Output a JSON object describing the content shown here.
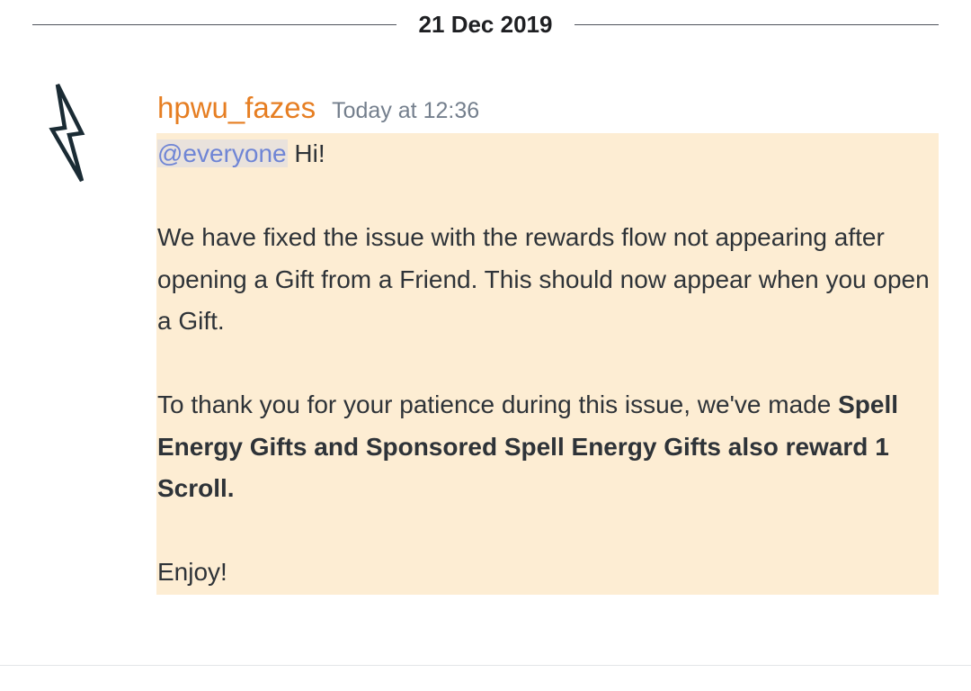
{
  "date_divider": {
    "label": "21 Dec 2019"
  },
  "message": {
    "author": {
      "username": "hpwu_fazes",
      "username_color": "#e67e22",
      "avatar_icon": "lightning-bolt-icon"
    },
    "timestamp": "Today at 12:36",
    "highlight_color": "#fdedd3",
    "mention": "@everyone",
    "greeting": " Hi!",
    "paragraph_1": "We have fixed the issue with the rewards flow not appearing after opening a Gift from a Friend. This should now appear when you open a Gift.",
    "paragraph_2_line_1": "To thank you for your patience during this issue, we've made",
    "paragraph_2_bold": "Spell Energy Gifts and Sponsored Spell Energy Gifts also reward 1 Scroll.",
    "closing": "Enjoy!"
  }
}
